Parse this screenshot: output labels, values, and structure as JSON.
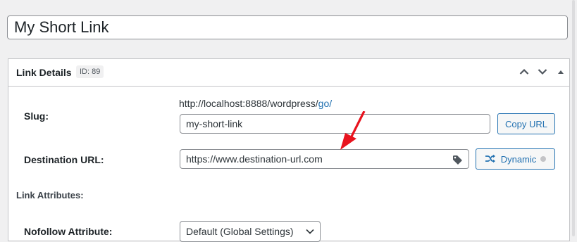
{
  "title": {
    "value": "My Short Link"
  },
  "panel": {
    "title": "Link Details",
    "id_badge": "ID: 89",
    "icons": {
      "move_up": "chevron-up-icon",
      "move_down": "chevron-down-icon",
      "toggle": "caret-up-icon"
    }
  },
  "slug": {
    "label": "Slug:",
    "base_url": "http://localhost:8888/wordpress/",
    "prefix": "go/",
    "value": "my-short-link",
    "copy_button": "Copy URL"
  },
  "destination": {
    "label": "Destination URL:",
    "value": "https://www.destination-url.com",
    "dynamic_button": "Dynamic",
    "icons": {
      "tag": "tag-icon",
      "shuffle": "shuffle-icon",
      "status": "status-dot-icon"
    }
  },
  "attributes": {
    "heading": "Link Attributes:"
  },
  "nofollow": {
    "label": "Nofollow Attribute:",
    "selected": "Default (Global Settings)"
  },
  "colors": {
    "accent": "#2271b1",
    "annotation": "#e8131e",
    "border": "#c3c4c7",
    "background": "#f0f0f1"
  }
}
